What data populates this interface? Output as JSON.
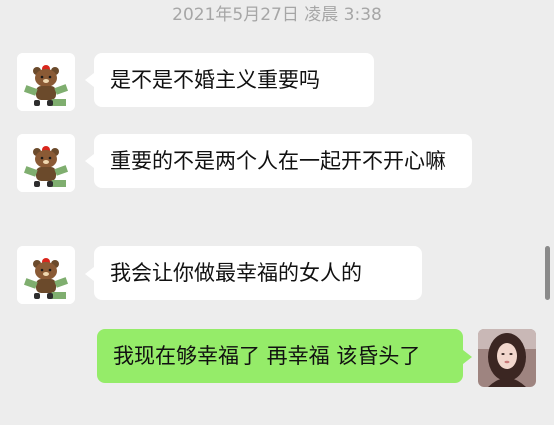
{
  "timestamp": "2021年5月27日 凌晨 3:38",
  "messages": [
    {
      "side": "in",
      "avatar": "brown-bear-sticker-avatar",
      "text": "是不是不婚主义重要吗"
    },
    {
      "side": "in",
      "avatar": "brown-bear-sticker-avatar",
      "text": "重要的不是两个人在一起开不开心嘛"
    },
    {
      "side": "in",
      "avatar": "brown-bear-sticker-avatar",
      "text": "我会让你做最幸福的女人的"
    },
    {
      "side": "out",
      "avatar": "user-photo-avatar",
      "text": "我现在够幸福了 再幸福 该昏头了"
    }
  ],
  "colors": {
    "background": "#ededed",
    "incoming_bubble": "#ffffff",
    "outgoing_bubble": "#95ec69",
    "timestamp_text": "#a6a6a6"
  }
}
